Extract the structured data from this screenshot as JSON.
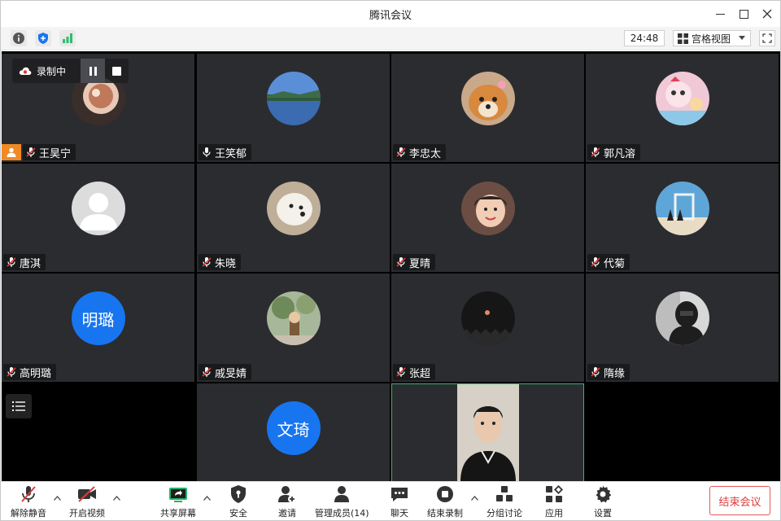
{
  "window": {
    "title": "腾讯会议"
  },
  "toolbar": {
    "timer": "24:48",
    "view_label": "宫格视图"
  },
  "recording": {
    "label": "录制中"
  },
  "participants": [
    {
      "name": "王昊宁",
      "mic": "muted",
      "host": true,
      "avatar": "photo-astronaut",
      "avatar_color": "#7a5a4a"
    },
    {
      "name": "王笑郁",
      "mic": "on",
      "avatar": "photo-lake",
      "avatar_color": "#3a78c8"
    },
    {
      "name": "李忠太",
      "mic": "muted",
      "avatar": "photo-dog",
      "avatar_color": "#d79a5a"
    },
    {
      "name": "郭凡溶",
      "mic": "muted",
      "avatar": "photo-cartoon",
      "avatar_color": "#e8a7b8"
    },
    {
      "name": "唐淇",
      "mic": "muted",
      "avatar": "default-person",
      "avatar_color": "#d9d9d9"
    },
    {
      "name": "朱晓",
      "mic": "muted",
      "avatar": "photo-white-dog",
      "avatar_color": "#c9b9a3"
    },
    {
      "name": "夏晴",
      "mic": "muted",
      "avatar": "photo-child",
      "avatar_color": "#a07a6a"
    },
    {
      "name": "代菊",
      "mic": "muted",
      "avatar": "photo-frame",
      "avatar_color": "#6aaad8"
    },
    {
      "name": "高明璐",
      "mic": "muted",
      "avatar_text": "明璐",
      "avatar_color": "#1875f0"
    },
    {
      "name": "戚旻婧",
      "mic": "muted",
      "avatar": "photo-tree",
      "avatar_color": "#8aa070"
    },
    {
      "name": "张超",
      "mic": "muted",
      "avatar": "photo-moon",
      "avatar_color": "#1a1a1a"
    },
    {
      "name": "隋缘",
      "mic": "muted",
      "avatar": "photo-person-dark",
      "avatar_color": "#555"
    },
    {
      "name": "",
      "avatar_text": "文琦",
      "avatar_color": "#1875f0"
    }
  ],
  "bottom": {
    "unmute": "解除静音",
    "video": "开启视频",
    "share": "共享屏幕",
    "security": "安全",
    "invite": "邀请",
    "members": "管理成员(14)",
    "chat": "聊天",
    "stop_record": "结束录制",
    "breakout": "分组讨论",
    "apps": "应用",
    "settings": "设置",
    "end_meeting": "结束会议"
  },
  "colors": {
    "accent": "#1875f0",
    "danger": "#e03c3c",
    "tile_bg": "#2b2c30",
    "host": "#f08a24",
    "active_border": "#2fbd6b"
  }
}
